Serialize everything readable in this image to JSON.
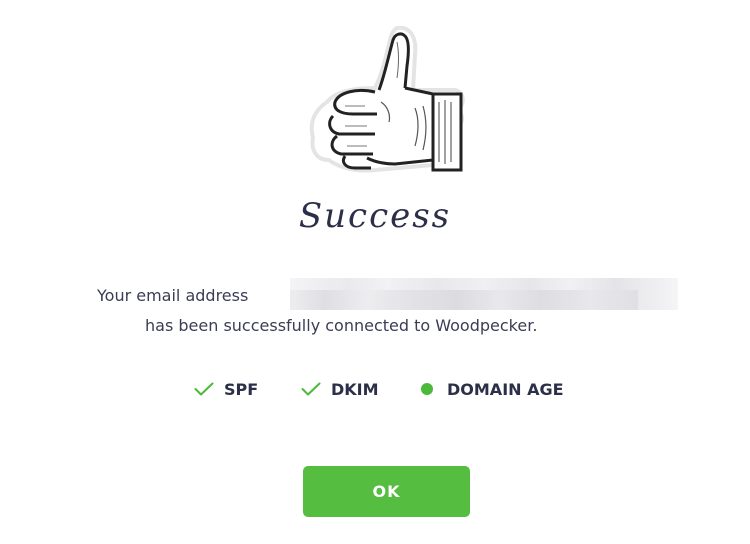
{
  "dialog": {
    "title": "Success",
    "message_prefix": "Your email address",
    "message_suffix": "has been successfully connected to Woodpecker.",
    "checks": [
      {
        "label": "SPF",
        "status": "passed",
        "icon": "check-icon"
      },
      {
        "label": "DKIM",
        "status": "passed",
        "icon": "check-icon"
      },
      {
        "label": "DOMAIN AGE",
        "status": "ok",
        "icon": "status-dot-icon"
      }
    ],
    "ok_label": "OK"
  },
  "colors": {
    "accent_green": "#55bd40",
    "check_green": "#4cb93b",
    "text_dark": "#2c2f48"
  }
}
